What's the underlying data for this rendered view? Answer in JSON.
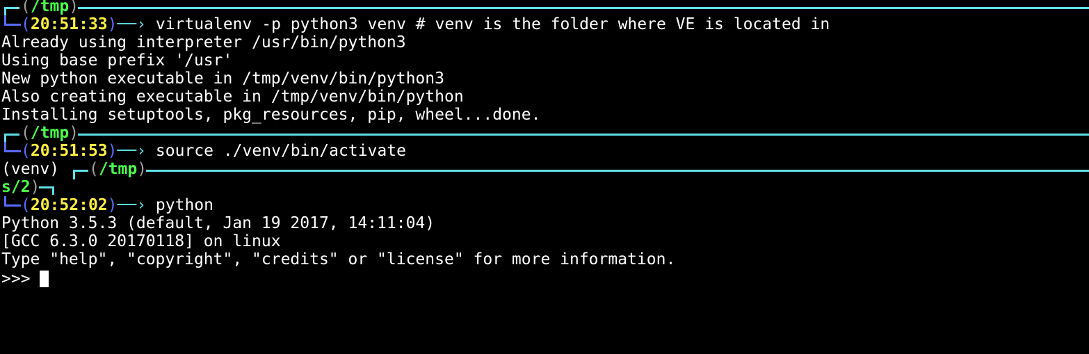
{
  "terminal": {
    "colors": {
      "background": "#000000",
      "frame": "#5fe1e6",
      "frame_blue": "#5a6cff",
      "directory": "#4cff4c",
      "time": "#ffee44",
      "text": "#ffffff"
    },
    "prompts": [
      {
        "dir": "/tmp",
        "time": "20:51:33",
        "command": "virtualenv -p python3 venv # venv is the folder where VE is located in"
      },
      {
        "dir": "/tmp",
        "time": "20:51:53",
        "command": "source ./venv/bin/activate"
      },
      {
        "env": "(venv)",
        "dir": "/tmp",
        "dir_wrap": "s/2",
        "time": "20:52:02",
        "command": "python"
      }
    ],
    "outputs": [
      [
        "Already using interpreter /usr/bin/python3",
        "Using base prefix '/usr'",
        "New python executable in /tmp/venv/bin/python3",
        "Also creating executable in /tmp/venv/bin/python",
        "Installing setuptools, pkg_resources, pip, wheel...done."
      ],
      [],
      [
        "Python 3.5.3 (default, Jan 19 2017, 14:11:04)",
        "[GCC 6.3.0 20170118] on linux",
        "Type \"help\", \"copyright\", \"credits\" or \"license\" for more information."
      ]
    ],
    "repl_prompt": ">>>"
  }
}
